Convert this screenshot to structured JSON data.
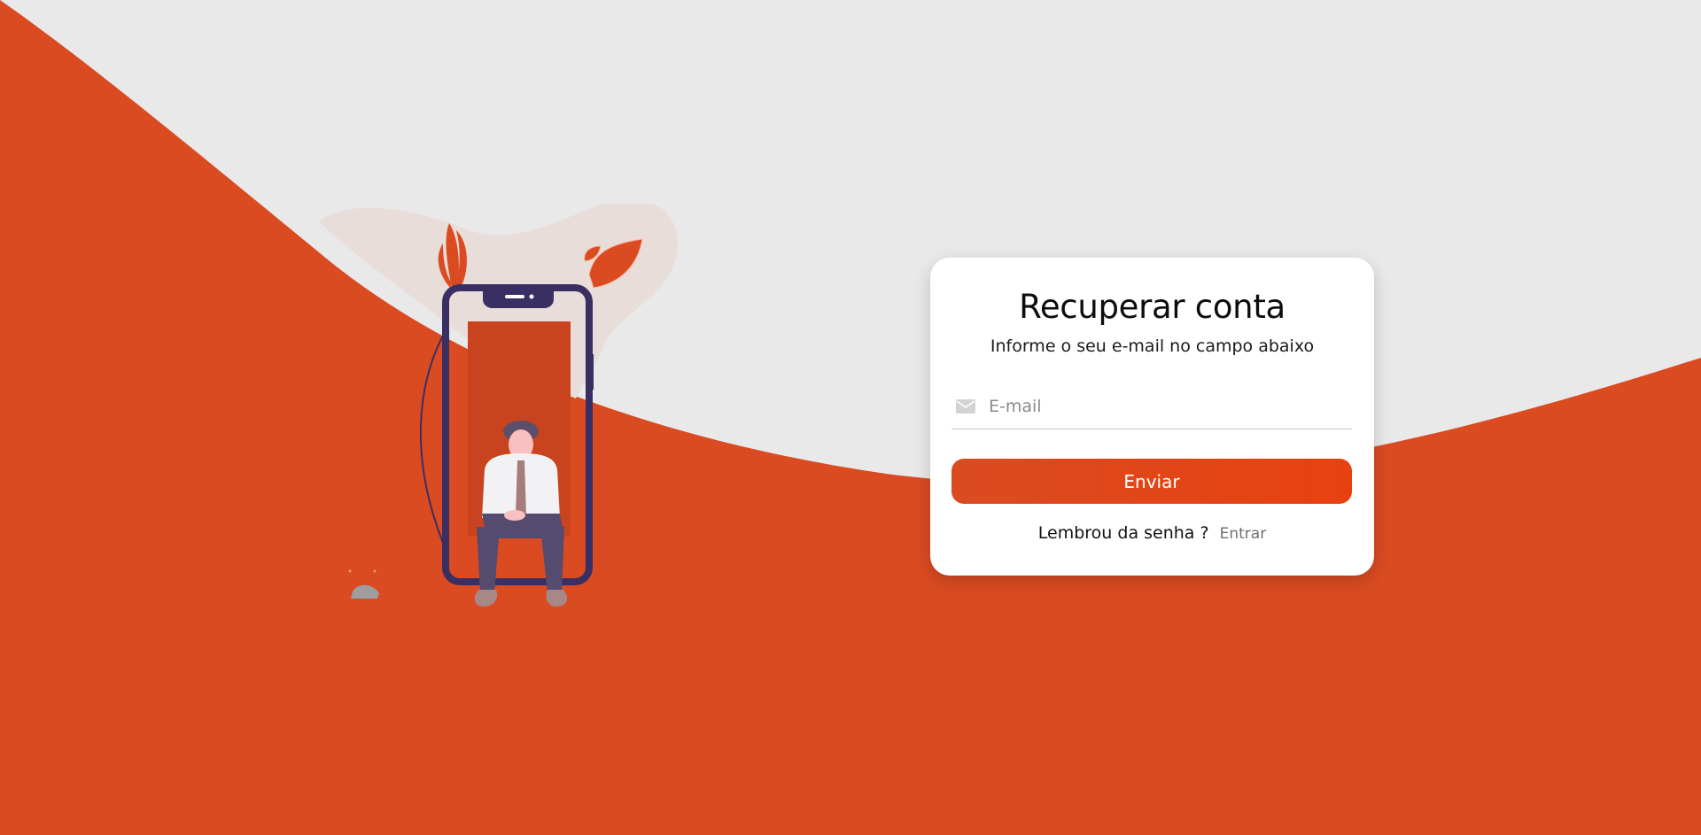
{
  "colors": {
    "primary": "#DA4B22",
    "button_gradient_end": "#E8410F",
    "background_light": "#E9E9E9",
    "card_background": "#FFFFFF",
    "phone_frame": "#3A2F63"
  },
  "recovery_card": {
    "title": "Recuperar conta",
    "subtitle": "Informe o seu e-mail no campo abaixo",
    "email_field": {
      "icon": "envelope-icon",
      "placeholder": "E-mail",
      "value": ""
    },
    "submit_label": "Enviar",
    "footer_text": "Lembrou da senha ?",
    "login_link_label": "Entrar"
  }
}
